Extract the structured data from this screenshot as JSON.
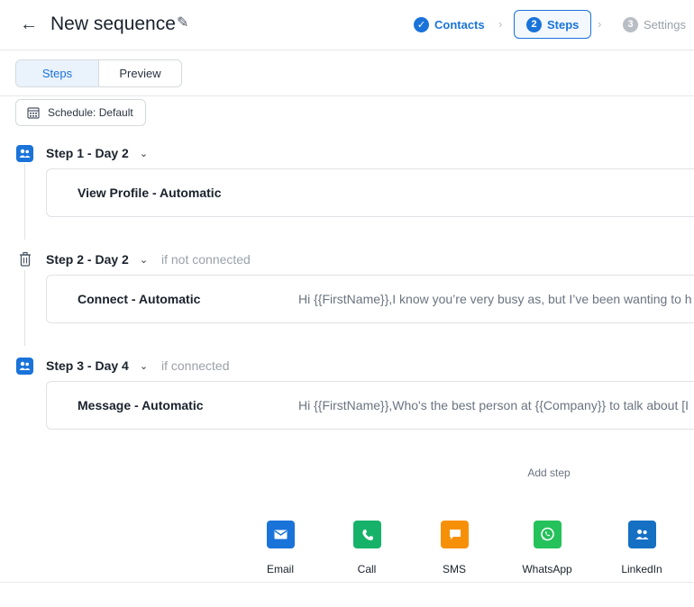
{
  "header": {
    "back_glyph": "←",
    "title": "New sequence",
    "edit_glyph": "✎",
    "stepper": [
      {
        "label": "Contacts",
        "marker": "✓",
        "state": "done"
      },
      {
        "label": "Steps",
        "marker": "2",
        "state": "active"
      },
      {
        "label": "Settings",
        "marker": "3",
        "state": "pending"
      }
    ],
    "separator": "›"
  },
  "view_toggle": {
    "options": [
      "Steps",
      "Preview"
    ],
    "selected": "Steps"
  },
  "schedule_label": "Schedule: Default",
  "steps": [
    {
      "title": "Step 1 - Day 2",
      "condition": "",
      "action": "View Profile - Automatic",
      "message": "",
      "icon": "linkedin-people-icon"
    },
    {
      "title": "Step 2 - Day 2",
      "condition": "if not connected",
      "action": "Connect - Automatic",
      "message": "Hi {{FirstName}},I know you’re very busy as, but I’ve been wanting to h",
      "icon": "trash-icon"
    },
    {
      "title": "Step 3 - Day 4",
      "condition": "if connected",
      "action": "Message - Automatic",
      "message": "Hi {{FirstName}},Who's the best person at {{Company}} to talk about [I",
      "icon": "linkedin-people-icon"
    }
  ],
  "chevron_glyph": "⌄",
  "add_step": {
    "label": "Add step",
    "channels": [
      {
        "label": "Email",
        "icon": "email-icon",
        "color": "#1a73d9"
      },
      {
        "label": "Call",
        "icon": "phone-icon",
        "color": "#17b26a"
      },
      {
        "label": "SMS",
        "icon": "sms-icon",
        "color": "#f79009"
      },
      {
        "label": "WhatsApp",
        "icon": "whatsapp-icon",
        "color": "#25c15a"
      },
      {
        "label": "LinkedIn",
        "icon": "linkedin-people-icon",
        "color": "#1570c4"
      }
    ]
  }
}
